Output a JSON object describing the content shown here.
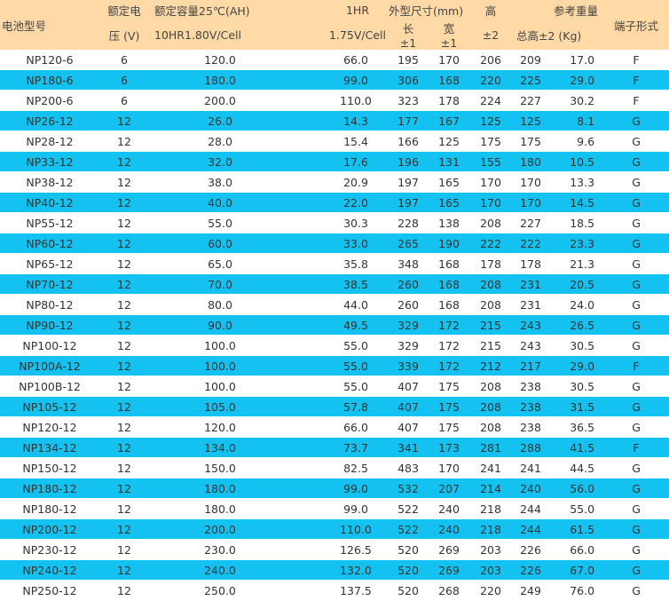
{
  "header": {
    "model": "电池型号",
    "voltage_line1": "额定电",
    "voltage_line2": "压 (V)",
    "capacity_group": "额定容量25℃(AH)",
    "capacity_10hr": "10HR1.80V/Cell",
    "capacity_1hr_line1": "1HR",
    "capacity_1hr_line2": "1.75V/Cell",
    "dimensions_group": "外型尺寸(mm)",
    "length_label": "长",
    "length_tol": "±1",
    "width_label": "宽",
    "width_tol": "±1",
    "height_label": "高",
    "height_tol": "±2",
    "weight_group": "参考重量",
    "total_height": "总高±2 (Kg)",
    "terminal": "端子形式"
  },
  "colors": {
    "header_bg": "#ffd9a6",
    "stripe_bg": "#14c2f2",
    "plain_bg": "#ffffff"
  },
  "rows": [
    {
      "model": "NP120-6",
      "voltage": "6",
      "cap10": "120.0",
      "cap1": "66.0",
      "length": "195",
      "width": "170",
      "height": "206",
      "total_height": "209",
      "weight": "17.0",
      "terminal": "F"
    },
    {
      "model": "NP180-6",
      "voltage": "6",
      "cap10": "180.0",
      "cap1": "99.0",
      "length": "306",
      "width": "168",
      "height": "220",
      "total_height": "225",
      "weight": "29.0",
      "terminal": "F"
    },
    {
      "model": "NP200-6",
      "voltage": "6",
      "cap10": "200.0",
      "cap1": "110.0",
      "length": "323",
      "width": "178",
      "height": "224",
      "total_height": "227",
      "weight": "30.2",
      "terminal": "F"
    },
    {
      "model": "NP26-12",
      "voltage": "12",
      "cap10": "26.0",
      "cap1": "14.3",
      "length": "177",
      "width": "167",
      "height": "125",
      "total_height": "125",
      "weight": "8.1",
      "terminal": "G"
    },
    {
      "model": "NP28-12",
      "voltage": "12",
      "cap10": "28.0",
      "cap1": "15.4",
      "length": "166",
      "width": "125",
      "height": "175",
      "total_height": "175",
      "weight": "9.6",
      "terminal": "G"
    },
    {
      "model": "NP33-12",
      "voltage": "12",
      "cap10": "32.0",
      "cap1": "17.6",
      "length": "196",
      "width": "131",
      "height": "155",
      "total_height": "180",
      "weight": "10.5",
      "terminal": "G"
    },
    {
      "model": "NP38-12",
      "voltage": "12",
      "cap10": "38.0",
      "cap1": "20.9",
      "length": "197",
      "width": "165",
      "height": "170",
      "total_height": "170",
      "weight": "13.3",
      "terminal": "G"
    },
    {
      "model": "NP40-12",
      "voltage": "12",
      "cap10": "40.0",
      "cap1": "22.0",
      "length": "197",
      "width": "165",
      "height": "170",
      "total_height": "170",
      "weight": "14.5",
      "terminal": "G"
    },
    {
      "model": "NP55-12",
      "voltage": "12",
      "cap10": "55.0",
      "cap1": "30.3",
      "length": "228",
      "width": "138",
      "height": "208",
      "total_height": "227",
      "weight": "18.5",
      "terminal": "G"
    },
    {
      "model": "NP60-12",
      "voltage": "12",
      "cap10": "60.0",
      "cap1": "33.0",
      "length": "265",
      "width": "190",
      "height": "222",
      "total_height": "222",
      "weight": "23.3",
      "terminal": "G"
    },
    {
      "model": "NP65-12",
      "voltage": "12",
      "cap10": "65.0",
      "cap1": "35.8",
      "length": "348",
      "width": "168",
      "height": "178",
      "total_height": "178",
      "weight": "21.3",
      "terminal": "G"
    },
    {
      "model": "NP70-12",
      "voltage": "12",
      "cap10": "70.0",
      "cap1": "38.5",
      "length": "260",
      "width": "168",
      "height": "208",
      "total_height": "231",
      "weight": "20.5",
      "terminal": "G"
    },
    {
      "model": "NP80-12",
      "voltage": "12",
      "cap10": "80.0",
      "cap1": "44.0",
      "length": "260",
      "width": "168",
      "height": "208",
      "total_height": "231",
      "weight": "24.0",
      "terminal": "G"
    },
    {
      "model": "NP90-12",
      "voltage": "12",
      "cap10": "90.0",
      "cap1": "49.5",
      "length": "329",
      "width": "172",
      "height": "215",
      "total_height": "243",
      "weight": "26.5",
      "terminal": "G"
    },
    {
      "model": "NP100-12",
      "voltage": "12",
      "cap10": "100.0",
      "cap1": "55.0",
      "length": "329",
      "width": "172",
      "height": "215",
      "total_height": "243",
      "weight": "30.5",
      "terminal": "G"
    },
    {
      "model": "NP100A-12",
      "voltage": "12",
      "cap10": "100.0",
      "cap1": "55.0",
      "length": "339",
      "width": "172",
      "height": "212",
      "total_height": "217",
      "weight": "29.0",
      "terminal": "F"
    },
    {
      "model": "NP100B-12",
      "voltage": "12",
      "cap10": "100.0",
      "cap1": "55.0",
      "length": "407",
      "width": "175",
      "height": "208",
      "total_height": "238",
      "weight": "30.5",
      "terminal": "G"
    },
    {
      "model": "NP105-12",
      "voltage": "12",
      "cap10": "105.0",
      "cap1": "57.8",
      "length": "407",
      "width": "175",
      "height": "208",
      "total_height": "238",
      "weight": "31.5",
      "terminal": "G"
    },
    {
      "model": "NP120-12",
      "voltage": "12",
      "cap10": "120.0",
      "cap1": "66.0",
      "length": "407",
      "width": "175",
      "height": "208",
      "total_height": "238",
      "weight": "36.5",
      "terminal": "G"
    },
    {
      "model": "NP134-12",
      "voltage": "12",
      "cap10": "134.0",
      "cap1": "73.7",
      "length": "341",
      "width": "173",
      "height": "281",
      "total_height": "288",
      "weight": "41.5",
      "terminal": "F"
    },
    {
      "model": "NP150-12",
      "voltage": "12",
      "cap10": "150.0",
      "cap1": "82.5",
      "length": "483",
      "width": "170",
      "height": "241",
      "total_height": "241",
      "weight": "44.5",
      "terminal": "G"
    },
    {
      "model": "NP180-12",
      "voltage": "12",
      "cap10": "180.0",
      "cap1": "99.0",
      "length": "532",
      "width": "207",
      "height": "214",
      "total_height": "240",
      "weight": "56.0",
      "terminal": "G"
    },
    {
      "model": "NP180-12",
      "voltage": "12",
      "cap10": "180.0",
      "cap1": "99.0",
      "length": "522",
      "width": "240",
      "height": "218",
      "total_height": "244",
      "weight": "55.0",
      "terminal": "G"
    },
    {
      "model": "NP200-12",
      "voltage": "12",
      "cap10": "200.0",
      "cap1": "110.0",
      "length": "522",
      "width": "240",
      "height": "218",
      "total_height": "244",
      "weight": "61.5",
      "terminal": "G"
    },
    {
      "model": "NP230-12",
      "voltage": "12",
      "cap10": "230.0",
      "cap1": "126.5",
      "length": "520",
      "width": "269",
      "height": "203",
      "total_height": "226",
      "weight": "66.0",
      "terminal": "G"
    },
    {
      "model": "NP240-12",
      "voltage": "12",
      "cap10": "240.0",
      "cap1": "132.0",
      "length": "520",
      "width": "269",
      "height": "203",
      "total_height": "226",
      "weight": "67.0",
      "terminal": "G"
    },
    {
      "model": "NP250-12",
      "voltage": "12",
      "cap10": "250.0",
      "cap1": "137.5",
      "length": "520",
      "width": "268",
      "height": "220",
      "total_height": "249",
      "weight": "76.0",
      "terminal": "G"
    }
  ]
}
